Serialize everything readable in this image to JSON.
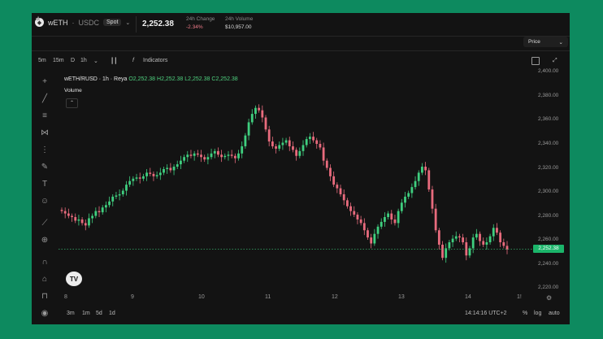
{
  "header": {
    "base": "wETH",
    "sep": "·",
    "quote": "USDC",
    "market_type": "Spot",
    "price": "2,252.38",
    "change_label": "24h Change",
    "change_value": "-2.34%",
    "volume_label": "24h Volume",
    "volume_value": "$10,957.00"
  },
  "price_selector": {
    "label": "Price"
  },
  "toolbar": {
    "intervals": [
      "5m",
      "15m",
      "D",
      "1h"
    ],
    "indicators_label": "Indicators"
  },
  "legend": {
    "title": "wETH/RUSD · 1h · Reya",
    "o": "O2,252.38",
    "h": "H2,252.38",
    "l": "L2,252.38",
    "c": "C2,252.38",
    "volume": "Volume"
  },
  "y_axis": {
    "ticks": [
      "2,400.00",
      "2,380.00",
      "2,360.00",
      "2,340.00",
      "2,320.00",
      "2,300.00",
      "2,280.00",
      "2,260.00",
      "2,240.00",
      "2,220.00"
    ],
    "last_price_tag": "2,252.38"
  },
  "x_axis": {
    "ticks": [
      "8",
      "9",
      "10",
      "11",
      "12",
      "13",
      "14",
      "1!"
    ]
  },
  "footer": {
    "ranges": [
      "3m",
      "1m",
      "5d",
      "1d"
    ],
    "time": "14:14:16 UTC+2",
    "pct": "%",
    "log": "log",
    "auto": "auto"
  },
  "colors": {
    "up": "#3fcf7f",
    "down": "#e86b7d",
    "background": "#131313",
    "tag": "#1bb56a"
  },
  "icons": [
    "eth-icon",
    "star-icon",
    "candles-icon",
    "function-icon",
    "crosshair-icon",
    "trendline-icon",
    "fib-icon",
    "pattern-icon",
    "measure-icon",
    "brush-icon",
    "text-icon",
    "emoji-icon",
    "ruler-icon",
    "zoom-icon",
    "magnet-icon",
    "lock-icon",
    "eye-icon",
    "settings-icon",
    "tradingview-logo"
  ],
  "chart_data": {
    "type": "candlestick",
    "x_labels": [
      "8",
      "9",
      "10",
      "11",
      "12",
      "13",
      "14"
    ],
    "ylim": [
      2216,
      2403
    ],
    "last": 2252.38,
    "close": [
      2284,
      2282,
      2280,
      2279,
      2276,
      2277,
      2274,
      2272,
      2278,
      2280,
      2284,
      2283,
      2287,
      2289,
      2292,
      2296,
      2297,
      2298,
      2301,
      2306,
      2309,
      2311,
      2312,
      2311,
      2313,
      2316,
      2315,
      2313,
      2314,
      2316,
      2319,
      2320,
      2318,
      2321,
      2323,
      2326,
      2329,
      2331,
      2330,
      2332,
      2331,
      2329,
      2327,
      2329,
      2332,
      2334,
      2331,
      2329,
      2330,
      2331,
      2330,
      2328,
      2332,
      2338,
      2347,
      2358,
      2365,
      2370,
      2368,
      2362,
      2352,
      2342,
      2338,
      2336,
      2339,
      2341,
      2343,
      2338,
      2335,
      2330,
      2334,
      2339,
      2344,
      2346,
      2343,
      2340,
      2337,
      2326,
      2320,
      2313,
      2306,
      2303,
      2298,
      2293,
      2288,
      2284,
      2281,
      2277,
      2274,
      2268,
      2262,
      2257,
      2265,
      2271,
      2275,
      2279,
      2282,
      2277,
      2274,
      2284,
      2291,
      2296,
      2299,
      2304,
      2309,
      2316,
      2321,
      2318,
      2302,
      2286,
      2268,
      2256,
      2245,
      2253,
      2258,
      2261,
      2263,
      2262,
      2258,
      2247,
      2253,
      2262,
      2265,
      2259,
      2256,
      2258,
      2263,
      2270,
      2266,
      2258,
      2255,
      2252
    ]
  }
}
